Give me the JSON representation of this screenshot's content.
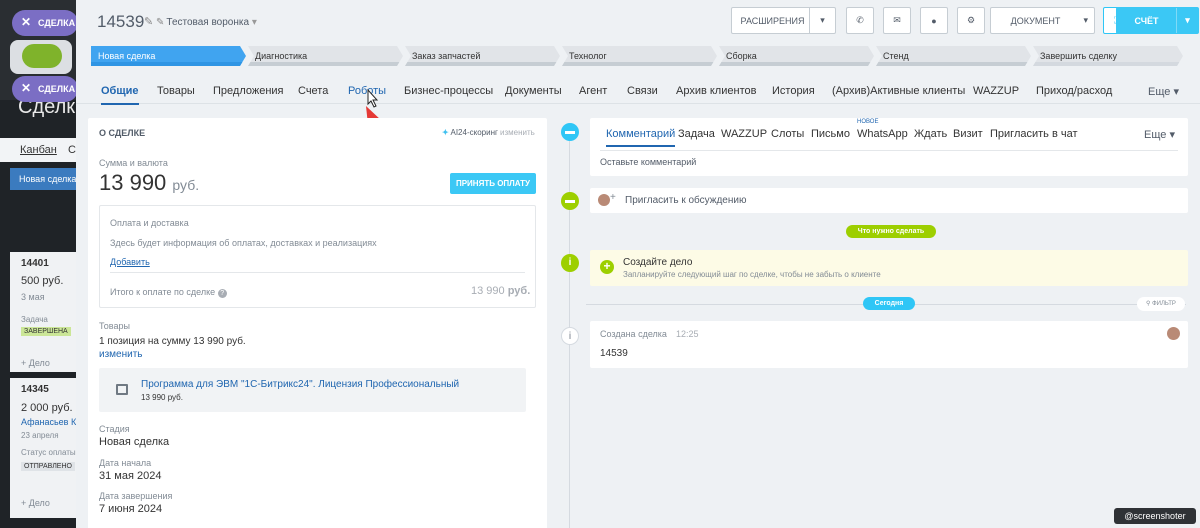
{
  "background": {
    "title": "Сделки",
    "tabs": [
      "Канбан",
      "Сп"
    ],
    "pill_deal": "СДЕЛКА",
    "pill_deal2": "СДЕЛКА",
    "selected_stage": "Новая сделка",
    "cards": [
      {
        "id": "14401",
        "amount": "500 руб.",
        "date": "3 мая",
        "field": "Задача",
        "badge": "ЗАВЕРШЕНА",
        "action": "+ Дело"
      },
      {
        "id": "14345",
        "amount": "2 000 руб.",
        "client": "Афанасьев Ко",
        "date": "23 апреля",
        "field": "Статус оплаты",
        "badge": "ОТПРАВЛЕНО",
        "action": "+ Дело"
      }
    ]
  },
  "header": {
    "deal_number": "14539",
    "funnel": "Тестовая воронка",
    "extensions": "РАСШИРЕНИЯ",
    "document": "ДОКУМЕНТ",
    "invoice": "СЧЁТ"
  },
  "stages": [
    "Новая сделка",
    "Диагностика",
    "Заказ запчастей",
    "Технолог",
    "Сборка",
    "Стенд",
    "Завершить сделку"
  ],
  "tabs": [
    "Общие",
    "Товары",
    "Предложения",
    "Счета",
    "Роботы",
    "Бизнес-процессы",
    "Документы",
    "Агент",
    "Связи",
    "Архив клиентов",
    "История",
    "(Архив)Активные клиенты",
    "WAZZUP",
    "Приход/расход"
  ],
  "tabs_more": "Еще",
  "about": {
    "section": "О СДЕЛКЕ",
    "ai": "AI24-скоринг",
    "change": "изменить",
    "sum_label": "Сумма и валюта",
    "sum_value": "13 990",
    "currency": "руб.",
    "pay_button": "ПРИНЯТЬ ОПЛАТУ",
    "payment_title": "Оплата и доставка",
    "payment_info": "Здесь будет информация об оплатах, доставках и реализациях",
    "add_link": "Добавить",
    "total_label": "Итого к оплате по сделке",
    "total_value": "13 990",
    "total_currency": "руб.",
    "goods_label": "Товары",
    "goods_summary": "1 позиция на сумму 13 990 руб.",
    "goods_change": "изменить",
    "product_name": "Программа для ЭВМ \"1С-Битрикс24\". Лицензия Профессиональный",
    "product_price": "13 990 руб.",
    "stage_label": "Стадия",
    "stage_value": "Новая сделка",
    "start_label": "Дата начала",
    "start_value": "31 мая 2024",
    "end_label": "Дата завершения",
    "end_value": "7 июня 2024"
  },
  "timeline": {
    "tabs": [
      "Комментарий",
      "Задача",
      "WAZZUP",
      "Слоты",
      "Письмо",
      "WhatsApp",
      "Ждать",
      "Визит",
      "Пригласить в чат"
    ],
    "new_badge": "НОВОЕ",
    "more": "Еще",
    "comment_placeholder": "Оставьте комментарий",
    "invite": "Пригласить к обсуждению",
    "todo_pill": "Что нужно сделать",
    "todo_title": "Создайте дело",
    "todo_hint": "Запланируйте следующий шаг по сделке, чтобы не забыть о клиенте",
    "today_pill": "Сегодня",
    "filter": "ФИЛЬТР",
    "created_title": "Создана сделка",
    "created_time": "12:25",
    "created_value": "14539"
  },
  "watermark": "@screenshoter",
  "colors": {
    "accent": "#3bc8f5",
    "link": "#2066b0",
    "stage_active": "#40a4f0",
    "green": "#9dcf00"
  }
}
